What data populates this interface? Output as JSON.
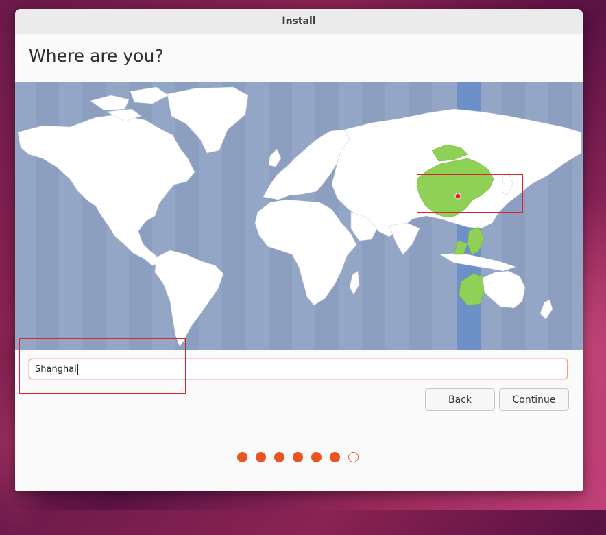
{
  "window": {
    "title": "Install"
  },
  "page": {
    "heading": "Where are you?"
  },
  "map": {
    "selected_region_color": "#8fd156",
    "selected_timezone_band_color": "#6d90c8",
    "ocean_color": "#94a6c6",
    "land_color": "#ffffff",
    "pin": "location-pin"
  },
  "timezone_field": {
    "value": "Shanghai"
  },
  "buttons": {
    "back": "Back",
    "continue": "Continue"
  },
  "progress": {
    "total_steps": 7,
    "current_step": 7,
    "accent_color": "#e95420"
  }
}
